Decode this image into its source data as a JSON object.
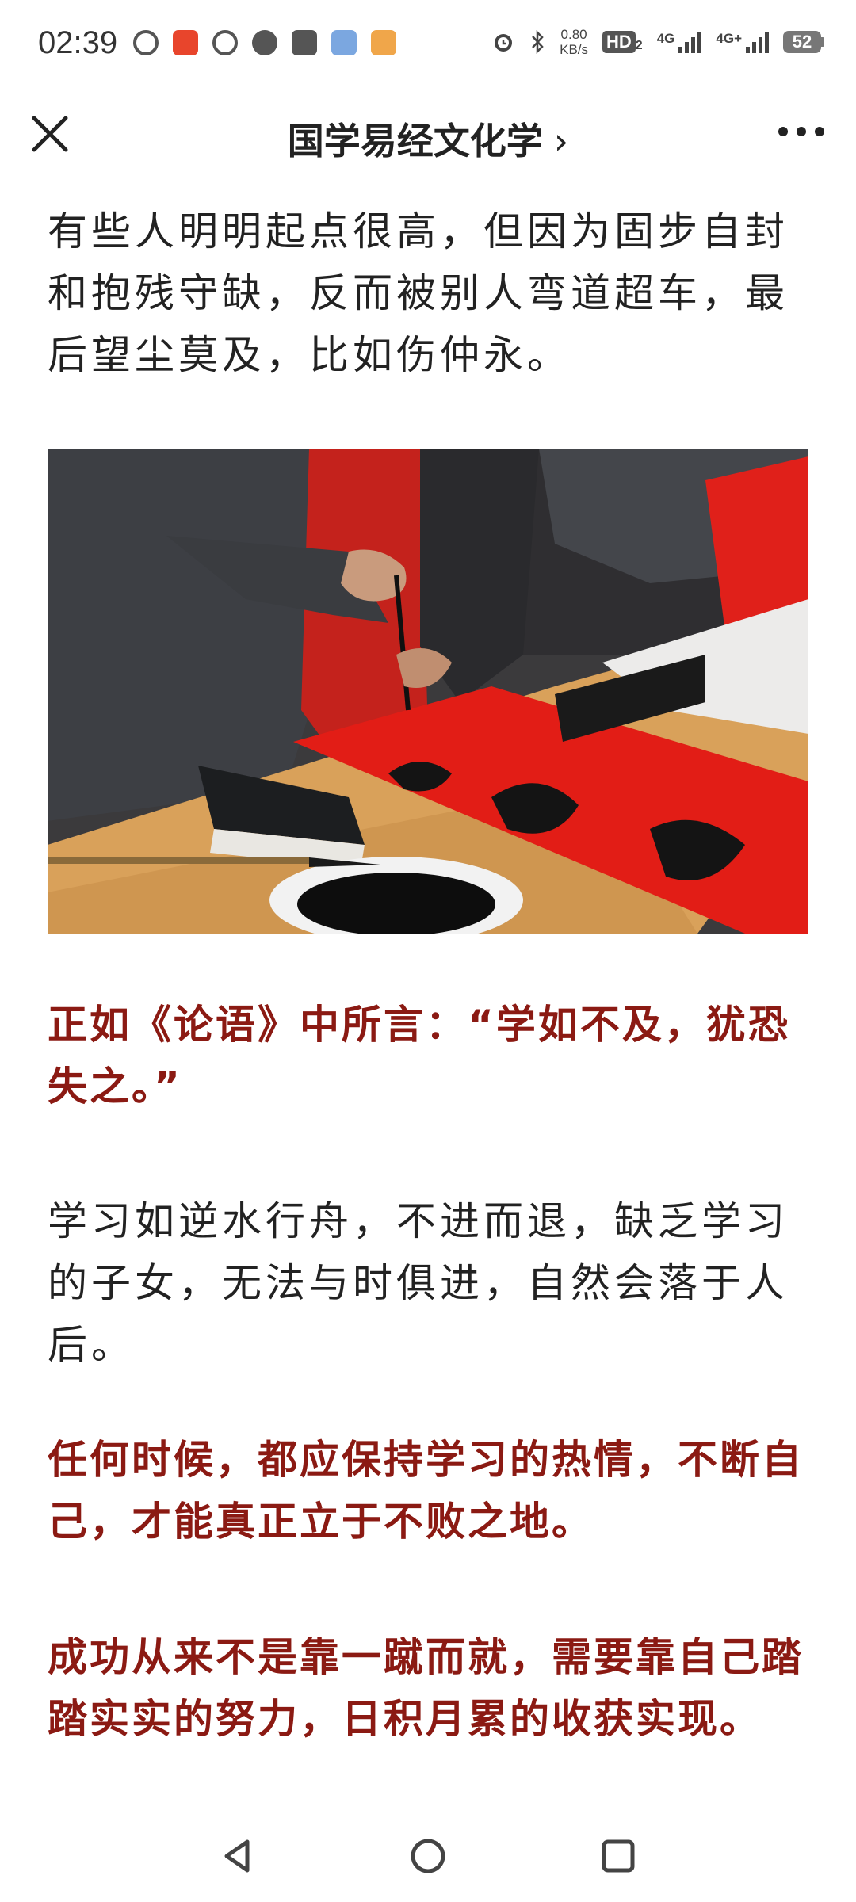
{
  "status_bar": {
    "time": "02:39",
    "net_speed_value": "0.80",
    "net_speed_unit": "KB/s",
    "hd_label": "HD",
    "hd_sub": "2",
    "signal1_label": "4G",
    "signal2_label": "4G+",
    "battery": "52",
    "notification_icons": [
      "sync-icon",
      "app-icon",
      "browser-icon",
      "message-icon",
      "telegram-icon",
      "cloud-app-icon",
      "game-app-icon"
    ]
  },
  "header": {
    "title": "国学易经文化学",
    "chevron": "›"
  },
  "article": {
    "p1": "有些人明明起点很高，但因为固步自封和抱残守缺，反而被别人弯道超车，最后望尘莫及，比如伤仲永。",
    "p2": "正如《论语》中所言：“学如不及，犹恐失之。”",
    "p3": "学习如逆水行舟，不进而退，缺乏学习的子女，无法与时俱进，自然会落于人后。",
    "p4": "任何时候，都应保持学习的热情，不断自己，才能真正立于不败之地。",
    "p5": "成功从来不是靠一蹴而就，需要靠自己踏踏实实的努力，日积月累的收获实现。"
  },
  "colors": {
    "emphasis": "#8b1a13",
    "body_text": "#222222"
  }
}
